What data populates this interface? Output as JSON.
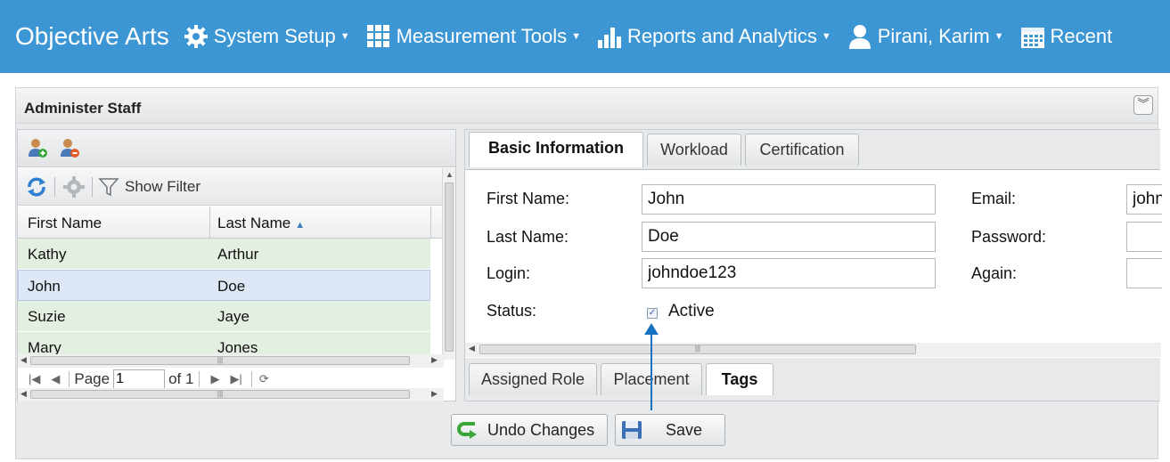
{
  "nav": {
    "brand": "Objective Arts",
    "items": [
      {
        "label": "System Setup",
        "icon": "gear-icon"
      },
      {
        "label": "Measurement Tools",
        "icon": "grid-icon"
      },
      {
        "label": "Reports and Analytics",
        "icon": "bar-chart-icon"
      },
      {
        "label": "Pirani, Karim",
        "icon": "user-icon"
      },
      {
        "label": "Recent",
        "icon": "calendar-icon"
      }
    ],
    "bg_color": "#3d96d4"
  },
  "panel": {
    "title": "Administer Staff"
  },
  "grid": {
    "show_filter": "Show Filter",
    "columns": [
      "First Name",
      "Last Name"
    ],
    "rows": [
      {
        "first": "Kathy",
        "last": "Arthur"
      },
      {
        "first": "John",
        "last": "Doe"
      },
      {
        "first": "Suzie",
        "last": "Jaye"
      },
      {
        "first": "Mary",
        "last": "Jones"
      }
    ],
    "selected_row": "John",
    "pager": {
      "page_label": "Page",
      "page_value": "1",
      "of_label": "of 1"
    }
  },
  "form": {
    "tabs": [
      "Basic Information",
      "Workload",
      "Certification"
    ],
    "active_tab": "Basic Information",
    "labels": {
      "first_name": "First Name:",
      "last_name": "Last Name:",
      "login": "Login:",
      "status": "Status:",
      "email": "Email:",
      "password": "Password:",
      "again": "Again:"
    },
    "values": {
      "first_name": "John",
      "last_name": "Doe",
      "login": "johndoe123",
      "email": "john",
      "status_checked": true,
      "status_text": "Active"
    },
    "subtabs": [
      "Assigned Role",
      "Placement",
      "Tags"
    ],
    "active_subtab": "Tags"
  },
  "buttons": {
    "undo": "Undo Changes",
    "save": "Save"
  }
}
